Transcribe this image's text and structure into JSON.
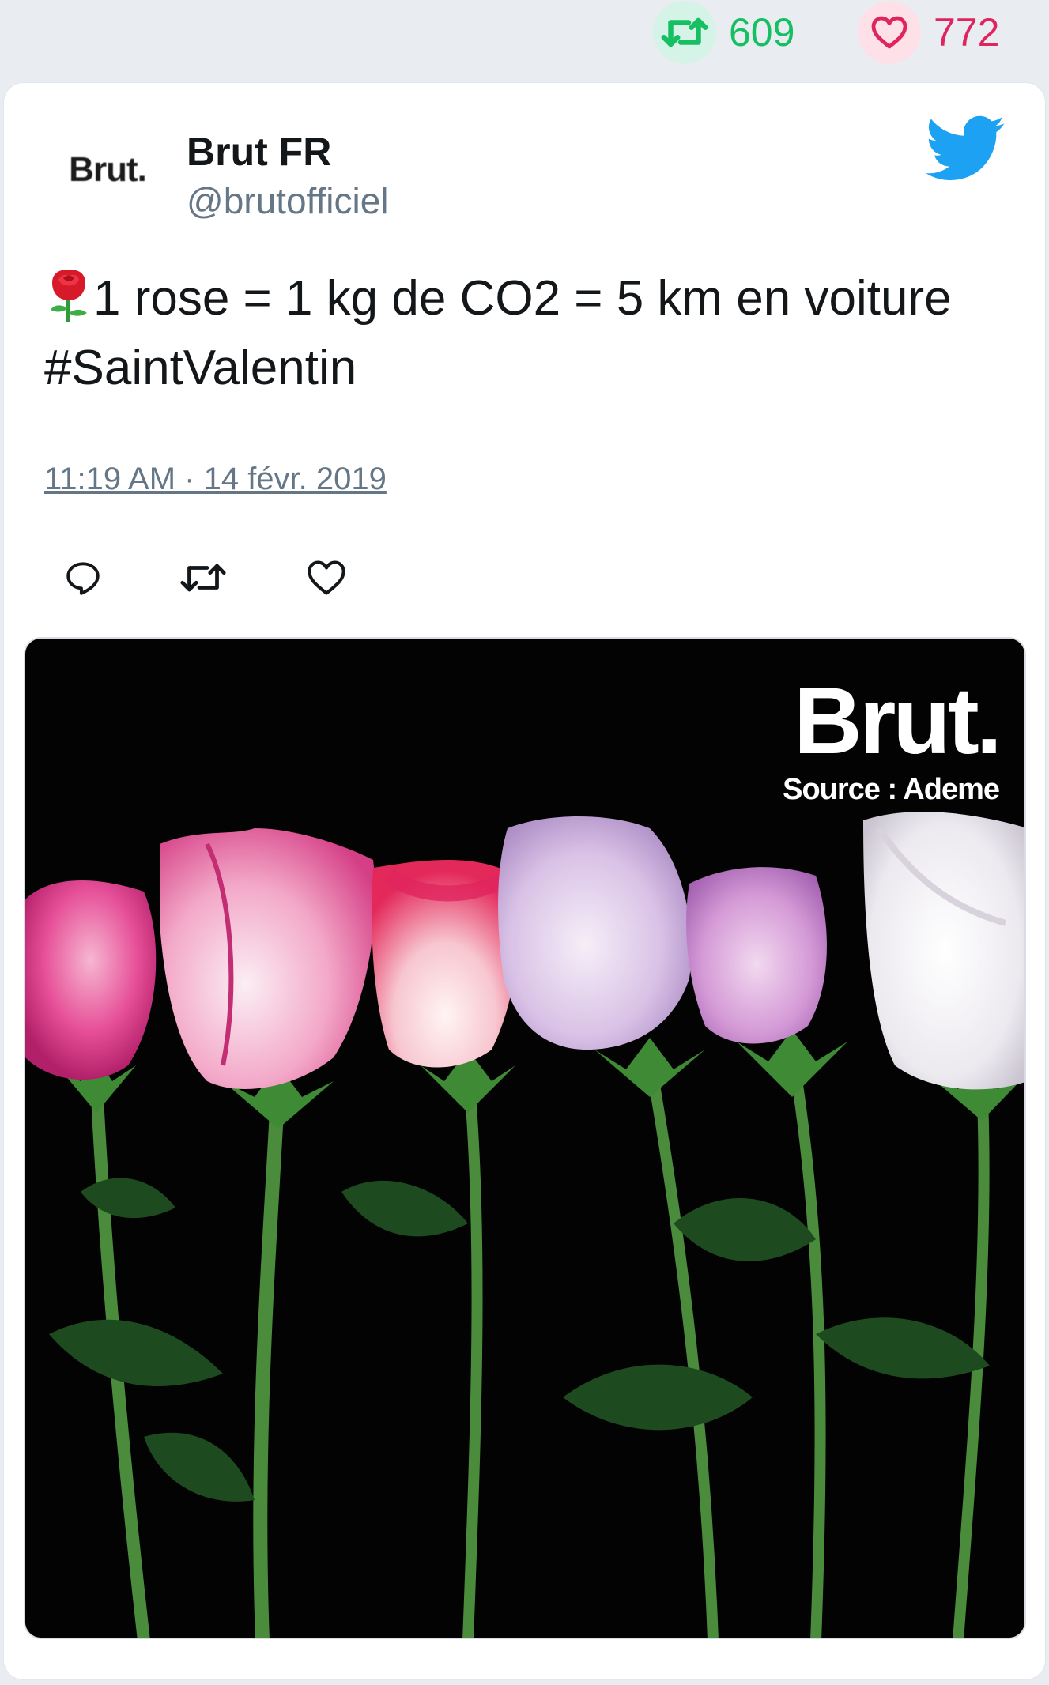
{
  "stats": {
    "retweets": "609",
    "likes": "772",
    "retweet_icon": "retweet-icon",
    "like_icon": "heart-icon"
  },
  "tweet": {
    "avatar_text": "Brut.",
    "display_name": "Brut FR",
    "handle": "@brutofficiel",
    "text": "1 rose = 1 kg de CO2 = 5 km en voiture #SaintValentin",
    "emoji": "rose-emoji",
    "timestamp": "11:19 AM · 14 févr. 2019",
    "actions": [
      "reply-icon",
      "retweet-icon",
      "heart-icon"
    ]
  },
  "media": {
    "brand": "Brut.",
    "source": "Source : Ademe",
    "description_icon": "roses-photo"
  },
  "colors": {
    "retweet": "#17bf63",
    "like": "#e0245e",
    "twitter_blue": "#1da1f2",
    "muted": "#657786"
  }
}
